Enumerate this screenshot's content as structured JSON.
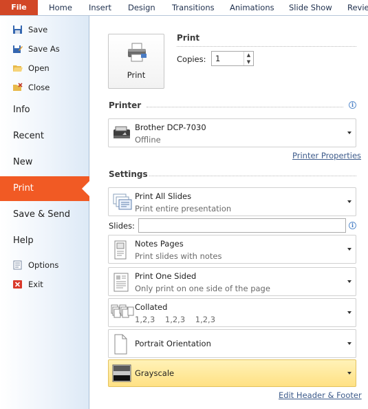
{
  "ribbon": {
    "tabs": [
      "File",
      "Home",
      "Insert",
      "Design",
      "Transitions",
      "Animations",
      "Slide Show",
      "Review"
    ]
  },
  "sidebar": {
    "top_items": [
      "Save",
      "Save As",
      "Open",
      "Close"
    ],
    "big_items": [
      "Info",
      "Recent",
      "New",
      "Print",
      "Save & Send",
      "Help"
    ],
    "bottom_items": [
      "Options",
      "Exit"
    ]
  },
  "print": {
    "heading": "Print",
    "button_label": "Print",
    "copies_label": "Copies:",
    "copies_value": "1"
  },
  "printer": {
    "heading": "Printer",
    "name": "Brother DCP-7030",
    "status": "Offline",
    "properties_link": "Printer Properties"
  },
  "settings": {
    "heading": "Settings",
    "slides_label": "Slides:",
    "slides_value": "",
    "range": {
      "title": "Print All Slides",
      "desc": "Print entire presentation"
    },
    "layout": {
      "title": "Notes Pages",
      "desc": "Print slides with notes"
    },
    "sides": {
      "title": "Print One Sided",
      "desc": "Only print on one side of the page"
    },
    "collate": {
      "title": "Collated",
      "desc": "1,2,3    1,2,3    1,2,3"
    },
    "orientation": {
      "title": "Portrait Orientation"
    },
    "color": {
      "title": "Grayscale"
    },
    "header_footer_link": "Edit Header & Footer"
  },
  "colors": {
    "file_tab": "#d24726",
    "print_selected": "#f15a24",
    "highlight": "#ffe184",
    "link": "#3c5a8a"
  }
}
